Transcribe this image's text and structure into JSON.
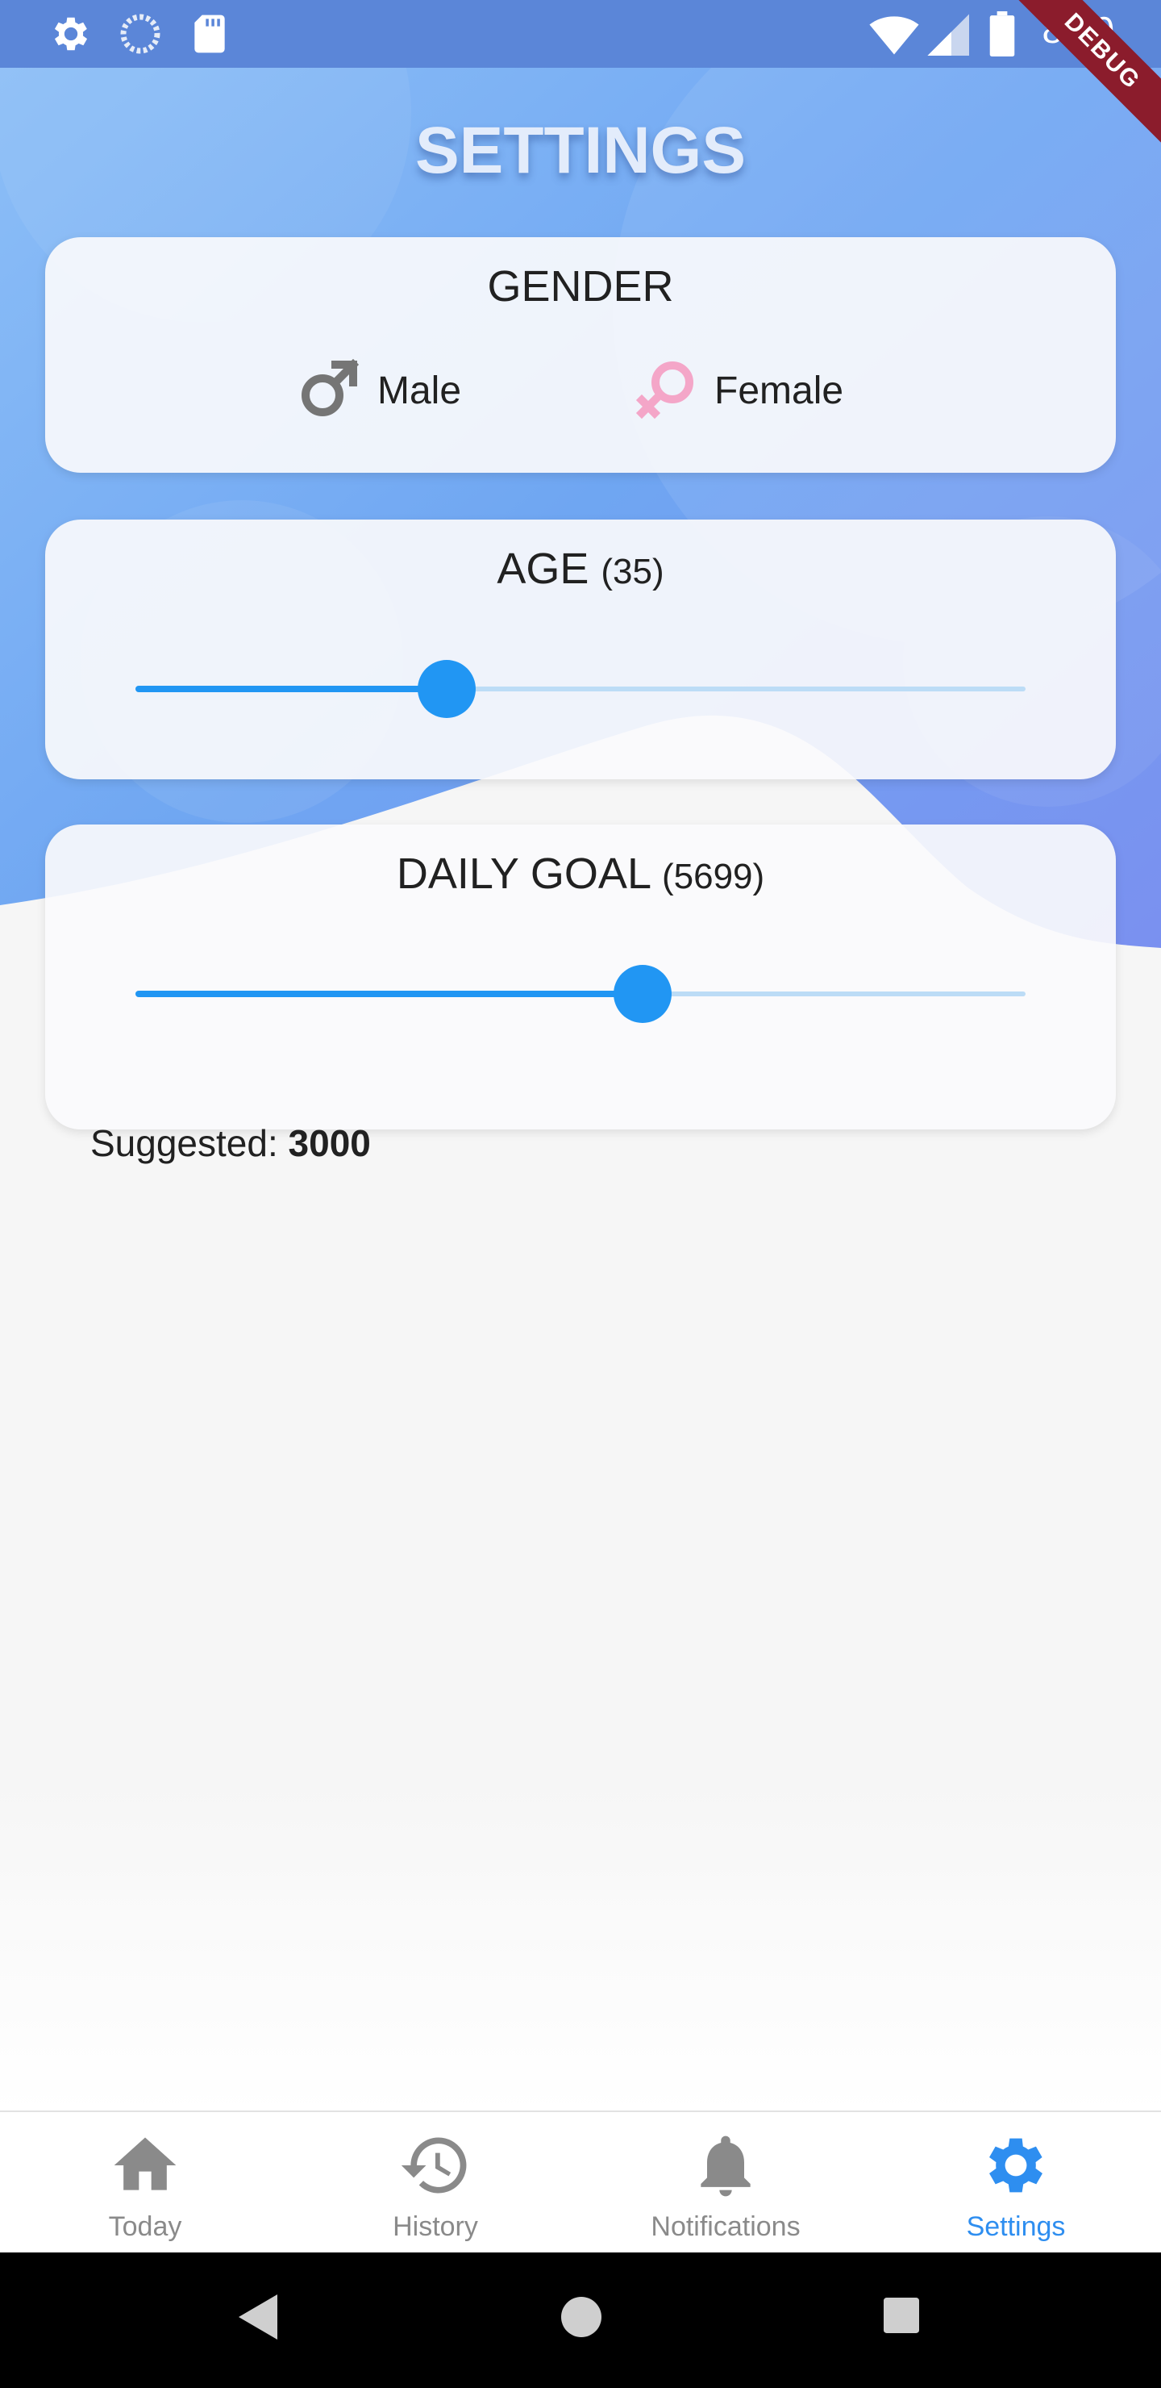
{
  "status_bar": {
    "time": "8:00",
    "left_icons": [
      "gear-icon",
      "loading-icon",
      "sd-card-icon"
    ],
    "right_icons": [
      "wifi-icon",
      "signal-icon",
      "battery-icon"
    ]
  },
  "debug_banner": "DEBUG",
  "page": {
    "title": "SETTINGS"
  },
  "gender": {
    "title": "GENDER",
    "options": [
      {
        "label": "Male",
        "icon": "male-symbol-icon",
        "color": "#757575"
      },
      {
        "label": "Female",
        "icon": "female-symbol-icon",
        "color": "#f4a6c8"
      }
    ]
  },
  "age": {
    "title": "AGE",
    "value_text": "(35)",
    "value": 35,
    "slider_fraction": 0.35
  },
  "daily_goal": {
    "title": "DAILY GOAL",
    "value_text": "(5699)",
    "value": 5699,
    "slider_fraction": 0.57,
    "suggested_label": "Suggested:",
    "suggested_value": "3000"
  },
  "bottom_nav": {
    "items": [
      {
        "label": "Today",
        "icon": "home-icon",
        "active": false
      },
      {
        "label": "History",
        "icon": "history-icon",
        "active": false
      },
      {
        "label": "Notifications",
        "icon": "bell-icon",
        "active": false
      },
      {
        "label": "Settings",
        "icon": "gear-icon",
        "active": true
      }
    ]
  },
  "colors": {
    "accent": "#2196f3",
    "active_nav": "#2e8ef0",
    "inactive_nav": "#8a8a8a",
    "header_blue": "#5b86d8"
  }
}
